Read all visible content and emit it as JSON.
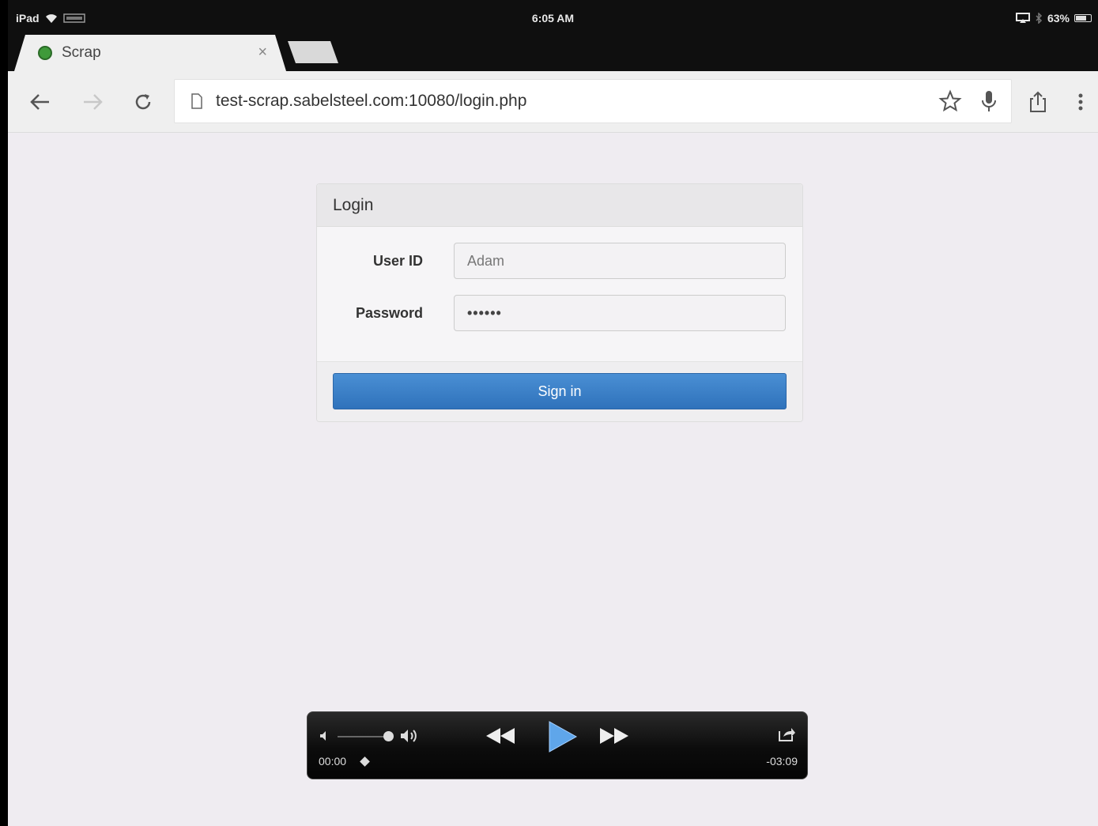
{
  "status_bar": {
    "device": "iPad",
    "time": "6:05 AM",
    "battery": "63%",
    "battery_level": 0.63
  },
  "browser": {
    "tab": {
      "title": "Scrap",
      "close": "×"
    },
    "url": "test-scrap.sabelsteel.com:10080/login.php"
  },
  "login": {
    "title": "Login",
    "user_label": "User ID",
    "user_value": "Adam",
    "password_label": "Password",
    "password_value": "••••••",
    "submit": "Sign in"
  },
  "player": {
    "elapsed": "00:00",
    "remaining": "-03:09"
  },
  "colors": {
    "primary_button": "#337ab7",
    "page_background": "#efecf1",
    "favicon": "#3f9a3a"
  }
}
